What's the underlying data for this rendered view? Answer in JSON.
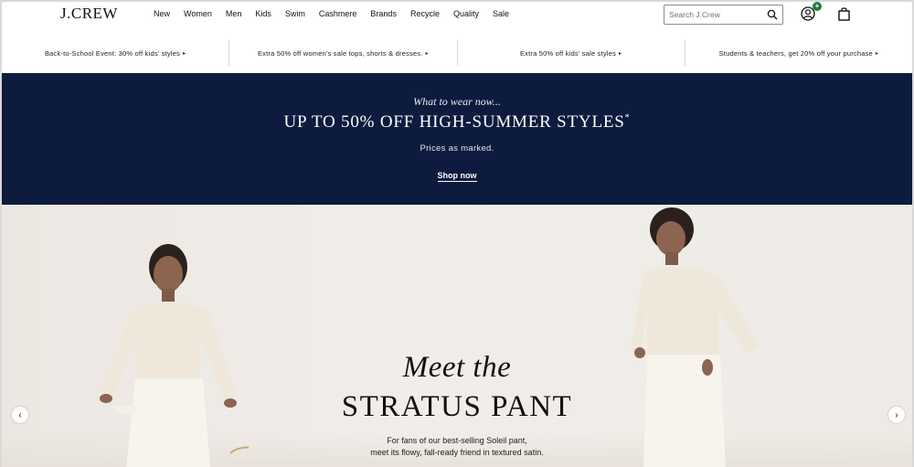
{
  "header": {
    "logo": "J.CREW",
    "nav": [
      "New",
      "Women",
      "Men",
      "Kids",
      "Swim",
      "Cashmere",
      "Brands",
      "Recycle",
      "Quality",
      "Sale"
    ],
    "search": {
      "placeholder": "Search J.Crew"
    },
    "cart_badge": "+"
  },
  "promos": [
    {
      "text": "Back-to-School Event: 30% off kids' styles"
    },
    {
      "text": "Extra 50% off women's sale tops, shorts & dresses."
    },
    {
      "text": "Extra 50% off kids' sale styles"
    },
    {
      "text": "Students & teachers, get 20% off your purchase"
    }
  ],
  "promo_arrow": "▸",
  "banner": {
    "kicker": "What to wear now...",
    "headline": "UP TO 50% OFF HIGH-SUMMER STYLES",
    "headline_mark": "*",
    "sub": "Prices as marked.",
    "cta": "Shop now",
    "background": "#0d1b3e"
  },
  "hero": {
    "title_italic": "Meet the",
    "title_caps": "STRATUS PANT",
    "desc_line1": "For fans of our best-selling Soleil pant,",
    "desc_line2": "meet its flowy, fall-ready friend in textured satin.",
    "prev": "‹",
    "next": "›"
  },
  "icons": [
    "search-icon",
    "account-icon",
    "bag-icon",
    "chevron-left-icon",
    "chevron-right-icon"
  ],
  "colors": {
    "accent_navy": "#0d1b3e",
    "badge_green": "#1e7b3b"
  }
}
